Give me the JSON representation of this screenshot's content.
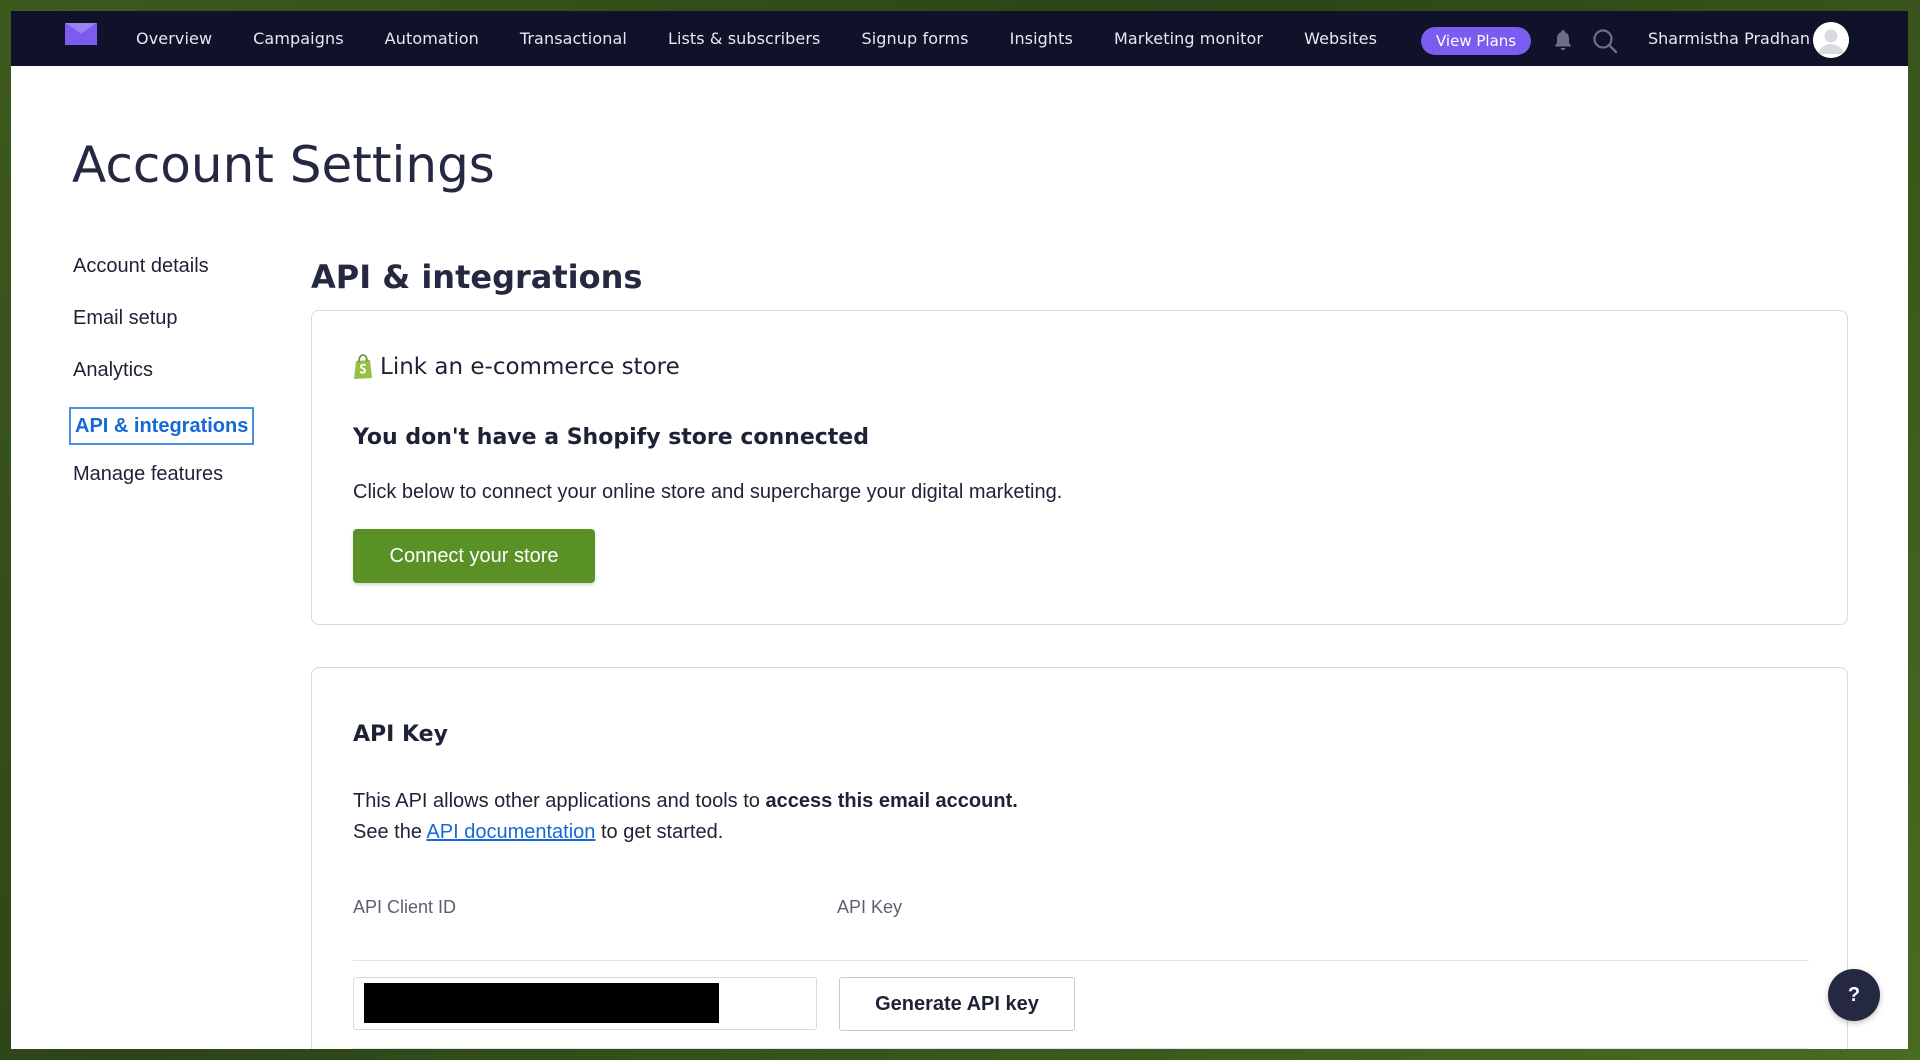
{
  "nav": {
    "items": [
      {
        "label": "Overview"
      },
      {
        "label": "Campaigns"
      },
      {
        "label": "Automation"
      },
      {
        "label": "Transactional"
      },
      {
        "label": "Lists & subscribers"
      },
      {
        "label": "Signup forms"
      },
      {
        "label": "Insights"
      },
      {
        "label": "Marketing monitor"
      },
      {
        "label": "Websites"
      }
    ],
    "view_plans_label": "View Plans",
    "user_name": "Sharmistha Pradhan",
    "brand_color": "#7b5cf0"
  },
  "page": {
    "title": "Account Settings"
  },
  "sidebar": {
    "items": [
      {
        "label": "Account details"
      },
      {
        "label": "Email setup"
      },
      {
        "label": "Analytics"
      },
      {
        "label": "API & integrations",
        "active": true
      },
      {
        "label": "Manage features"
      }
    ]
  },
  "main": {
    "section_title": "API & integrations",
    "ecommerce": {
      "heading": "Link an e-commerce store",
      "subheading": "You don't have a Shopify store connected",
      "body": "Click below to connect your online store and supercharge your digital marketing.",
      "button_label": "Connect your store",
      "button_color": "#5a9127"
    },
    "api": {
      "heading": "API Key",
      "line1_prefix": "This API allows other applications and tools to ",
      "line1_bold": "access this email account.",
      "line2_prefix": "See the ",
      "line2_link": "API documentation",
      "line2_suffix": " to get started.",
      "client_id_label": "API Client ID",
      "api_key_label": "API Key",
      "generate_button_label": "Generate API key"
    }
  },
  "help": {
    "label": "?"
  }
}
